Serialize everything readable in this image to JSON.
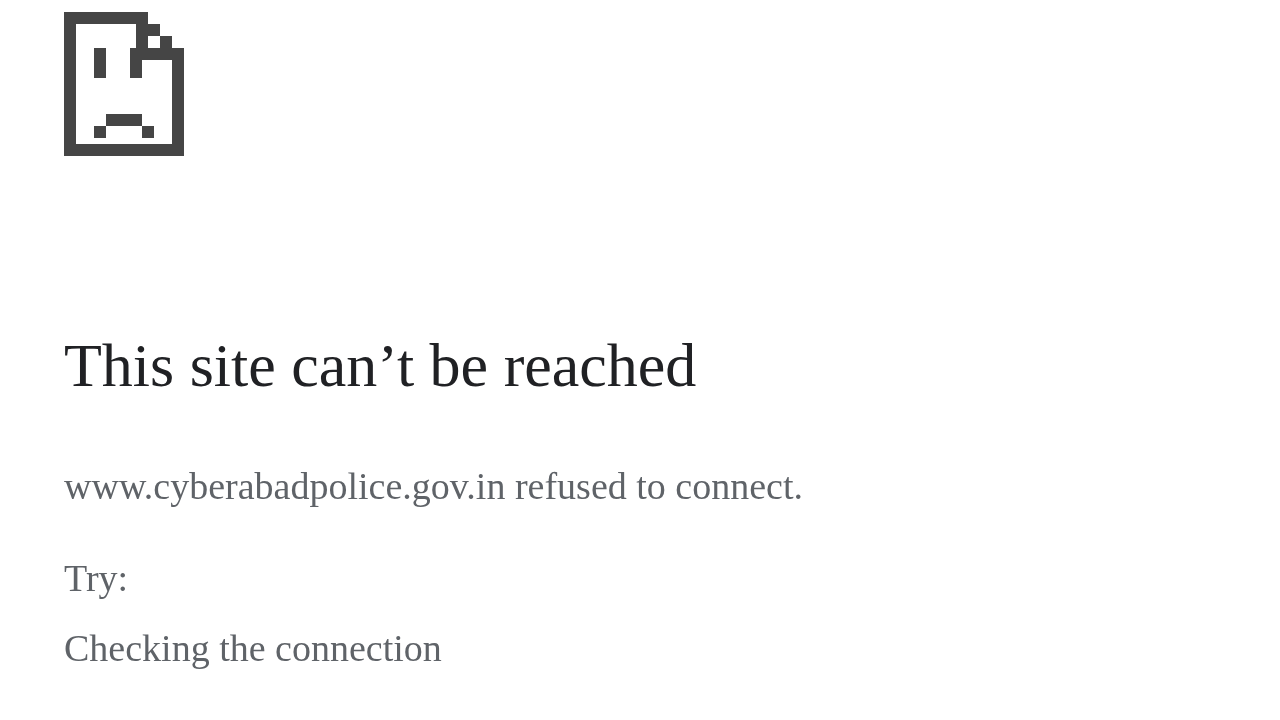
{
  "heading": "This site can’t be reached",
  "message": "www.cyberabadpolice.gov.in refused to connect.",
  "suggestions_label": "Try:",
  "suggestions": [
    "Checking the connection"
  ]
}
